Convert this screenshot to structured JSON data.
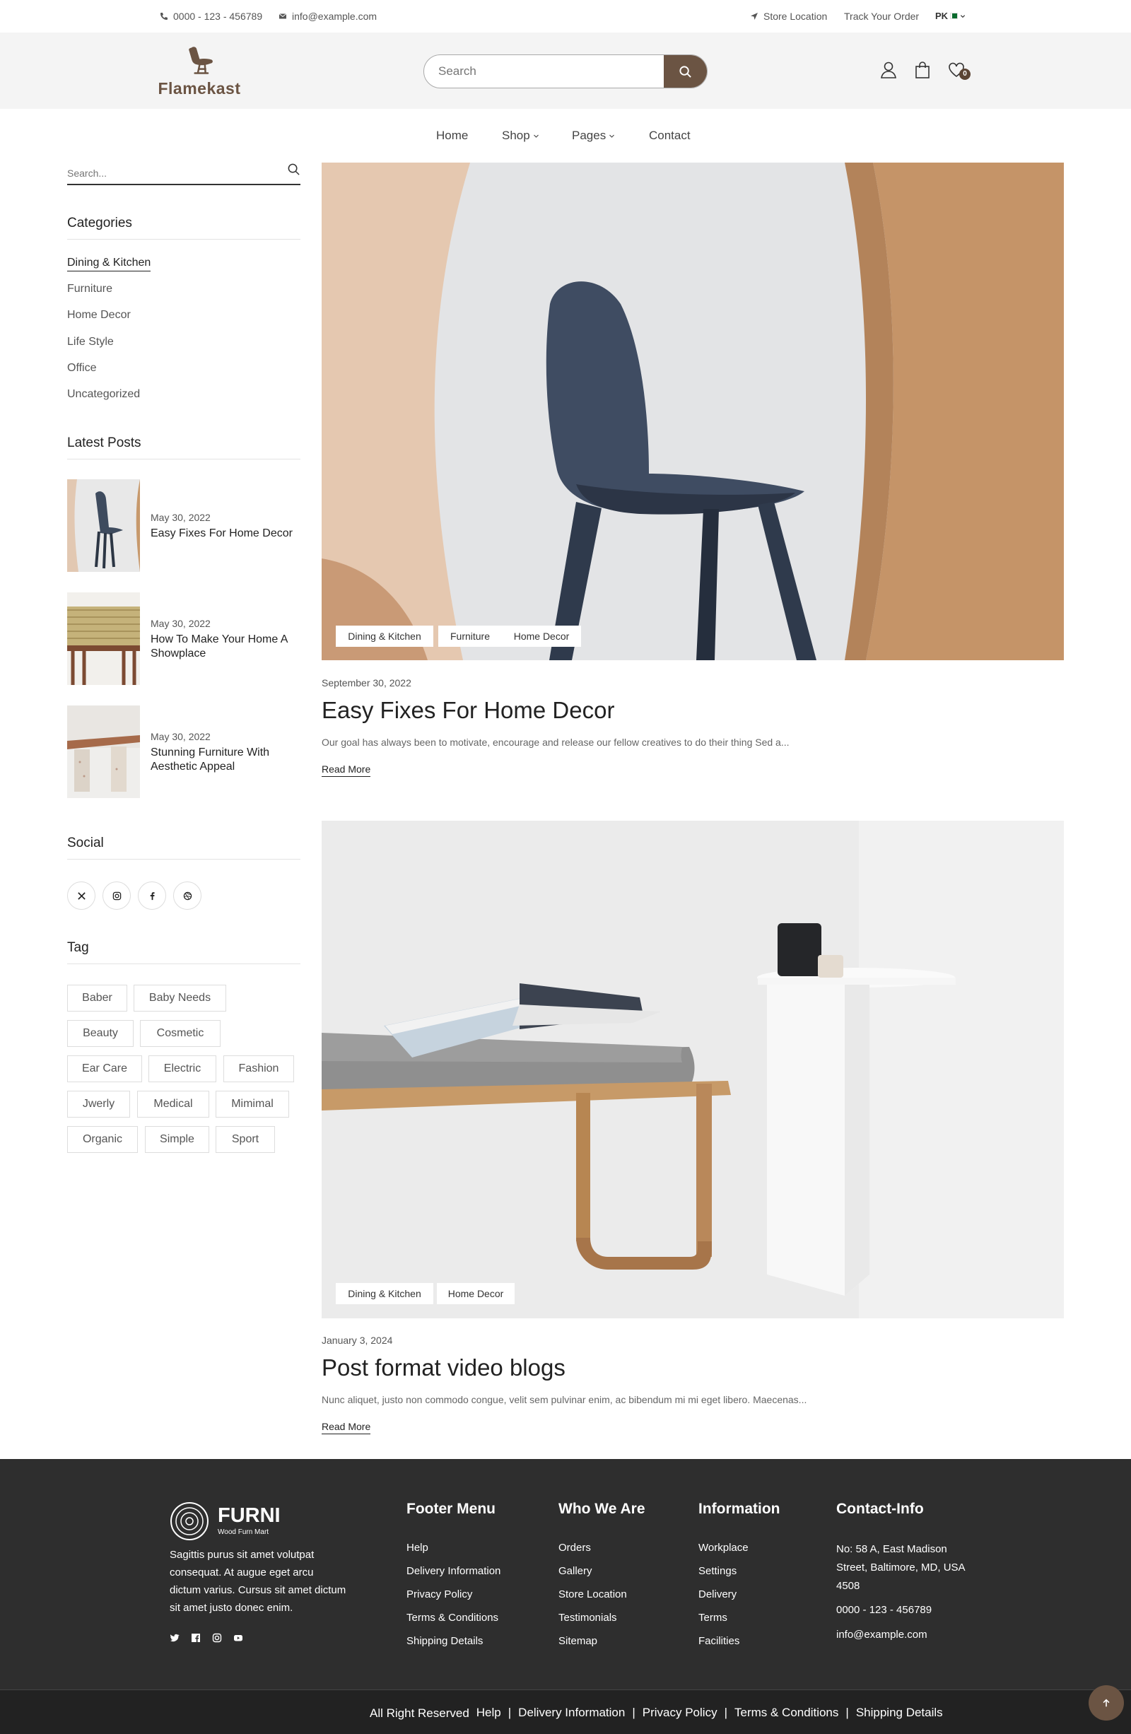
{
  "topbar": {
    "phone": "0000 - 123 - 456789",
    "email": "info@example.com",
    "store_location": "Store Location",
    "track_order": "Track Your Order",
    "currency": "PK"
  },
  "header": {
    "logo_text": "Flamekast",
    "search_placeholder": "Search",
    "cart_count": "0",
    "brand_color": "#6b5443"
  },
  "nav": {
    "items": [
      {
        "label": "Home"
      },
      {
        "label": "Shop"
      },
      {
        "label": "Pages"
      },
      {
        "label": "Contact"
      }
    ]
  },
  "sidebar": {
    "search_placeholder": "Search...",
    "categories_title": "Categories",
    "categories": [
      "Dining & Kitchen",
      "Furniture",
      "Home Decor",
      "Life Style",
      "Office",
      "Uncategorized"
    ],
    "latest_title": "Latest Posts",
    "latest_posts": [
      {
        "date": "May 30, 2022",
        "title": "Easy Fixes For Home Decor"
      },
      {
        "date": "May 30, 2022",
        "title": "How To Make Your Home A Showplace"
      },
      {
        "date": "May 30, 2022",
        "title": "Stunning Furniture With Aesthetic Appeal"
      }
    ],
    "social_title": "Social",
    "social_icons": [
      "x-icon",
      "instagram-icon",
      "facebook-icon",
      "dribbble-icon"
    ],
    "tag_title": "Tag",
    "tags": [
      "Baber",
      "Baby Needs",
      "Beauty",
      "Cosmetic",
      "Ear Care",
      "Electric",
      "Fashion",
      "Jwerly",
      "Medical",
      "Mimimal",
      "Organic",
      "Simple",
      "Sport"
    ]
  },
  "posts": [
    {
      "categories": [
        "Dining & Kitchen",
        "Furniture",
        "Home Decor"
      ],
      "date": "September 30, 2022",
      "title": "Easy Fixes For Home Decor",
      "excerpt": "Our goal has always been to motivate, encourage and release our fellow creatives to do their thing Sed a...",
      "read_more": "Read More"
    },
    {
      "categories": [
        "Dining & Kitchen",
        "Home Decor"
      ],
      "date": "January 3, 2024",
      "title": "Post format video blogs",
      "excerpt": "Nunc aliquet, justo non commodo congue, velit sem pulvinar enim, ac bibendum mi mi eget libero. Maecenas...",
      "read_more": "Read More"
    }
  ],
  "footer": {
    "logo_name": "FURNI",
    "logo_sub": "Wood Furn Mart",
    "about": "Sagittis purus sit amet volutpat consequat. At augue eget arcu dictum varius. Cursus sit amet dictum sit amet justo donec enim.",
    "columns": [
      {
        "title": "Footer Menu",
        "links": [
          "Help",
          "Delivery Information",
          "Privacy Policy",
          "Terms & Conditions",
          "Shipping Details"
        ]
      },
      {
        "title": "Who We Are",
        "links": [
          "Orders",
          "Gallery",
          "Store Location",
          "Testimonials",
          "Sitemap"
        ]
      },
      {
        "title": "Information",
        "links": [
          "Workplace",
          "Settings",
          "Delivery",
          "Terms",
          "Facilities"
        ]
      }
    ],
    "contact_title": "Contact-Info",
    "address": "No: 58 A, East Madison Street, Baltimore, MD, USA 4508",
    "phone": "0000 - 123 - 456789",
    "email": "info@example.com"
  },
  "bottom_bar": {
    "rights": "All Right Reserved",
    "links": [
      "Help",
      "Delivery Information",
      "Privacy Policy",
      "Terms & Conditions",
      "Shipping Details"
    ],
    "separator": "|"
  }
}
